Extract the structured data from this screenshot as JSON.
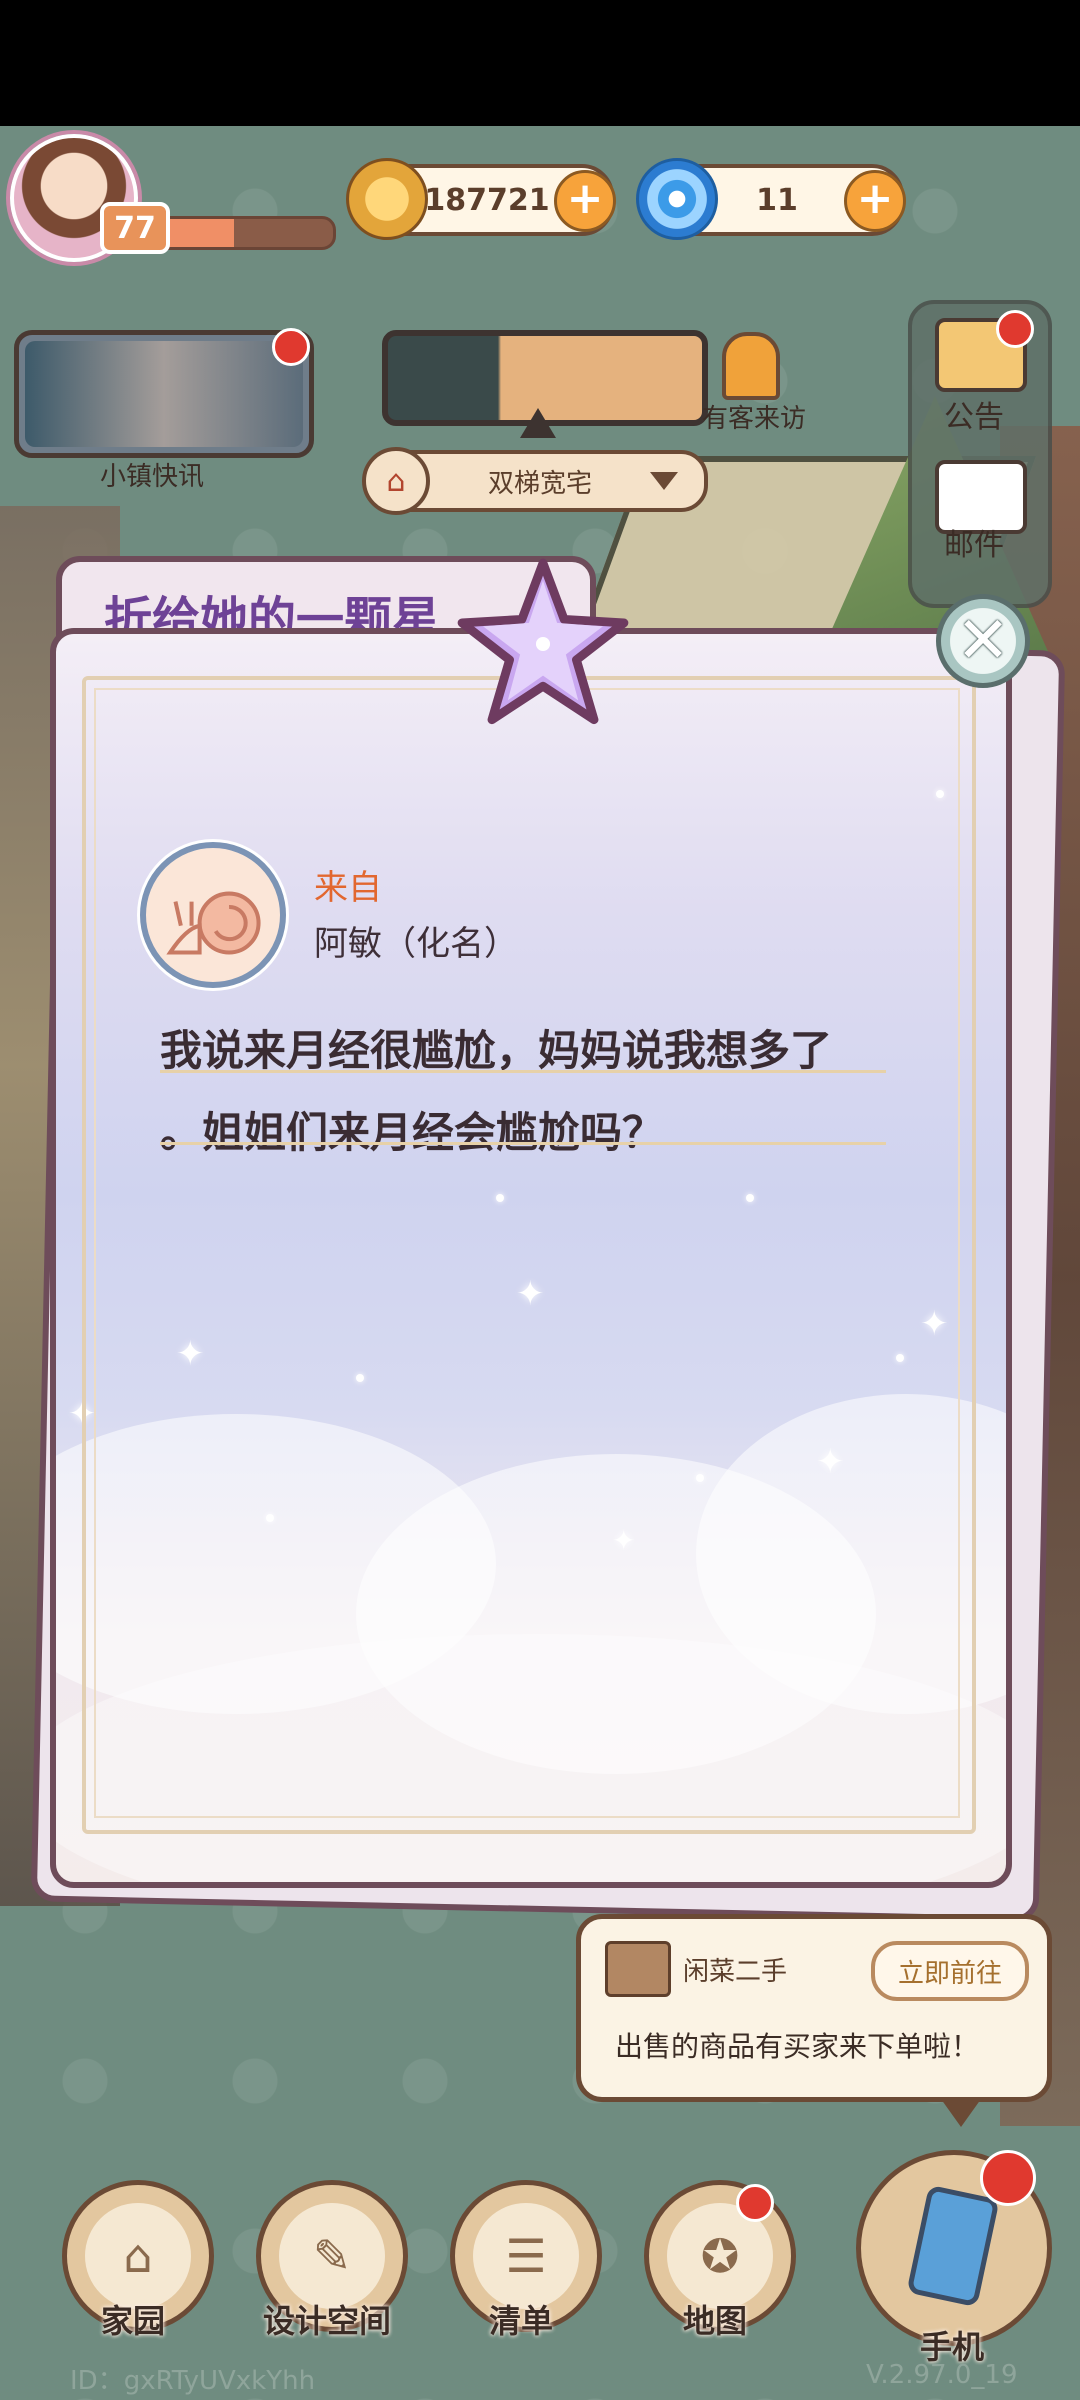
{
  "hud": {
    "level": "77",
    "xp_fraction": 0.45,
    "coins": "187721",
    "gems": "11",
    "coin_icon": "coin-icon",
    "gem_icon": "swirl-gem-icon"
  },
  "top": {
    "news_label": "小镇快讯",
    "visitor_label": "有客来访",
    "house_name": "双梯宽宅",
    "notice_label": "公告",
    "mail_label": "邮件"
  },
  "modal": {
    "tab_title": "折给她的一颗星",
    "from_label": "来自",
    "sender_name": "阿敏（化名）",
    "message_line1": "我说来月经很尴尬，妈妈说我想多了",
    "message_line2": "。姐姐们来月经会尴尬吗？",
    "close_symbol": "✕"
  },
  "notification": {
    "app_name": "闲菜二手",
    "goto_label": "立即前往",
    "body": "出售的商品有买家来下单啦！"
  },
  "nav": {
    "home": "家园",
    "design": "设计空间",
    "list": "清单",
    "map": "地图",
    "phone": "手机"
  },
  "footer": {
    "id": "ID：gxRTyUVxkYhh",
    "version": "V.2.97.0_19"
  },
  "colors": {
    "accent_title": "#6e4296",
    "from_label": "#e2672f",
    "badge_red": "#e0392f"
  }
}
